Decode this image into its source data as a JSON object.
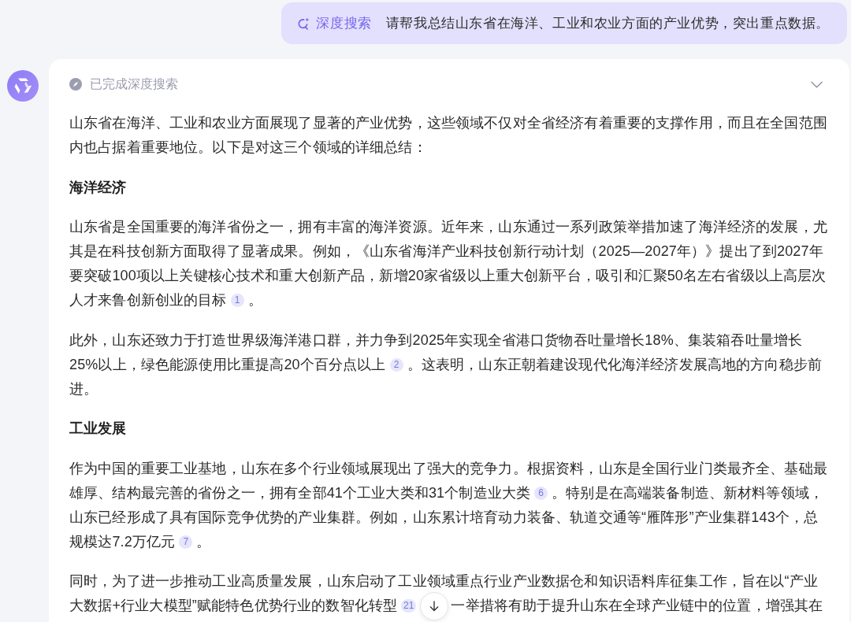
{
  "user_message": {
    "mode_tag": "深度搜索",
    "text": "请帮我总结山东省在海洋、工业和农业方面的产业优势，突出重点数据。"
  },
  "answer": {
    "status": "已完成深度搜索",
    "blocks": [
      {
        "kind": "paragraph",
        "segments": [
          {
            "kind": "text",
            "text": "山东省在海洋、工业和农业方面展现了显著的产业优势，这些领域不仅对全省经济有着重要的支撑作用，而且在全国范围内也占据着重要地位。以下是对这三个领域的详细总结："
          }
        ]
      },
      {
        "kind": "heading",
        "text": "海洋经济"
      },
      {
        "kind": "paragraph",
        "segments": [
          {
            "kind": "text",
            "text": "山东省是全国重要的海洋省份之一，拥有丰富的海洋资源。近年来，山东通过一系列政策举措加速了海洋经济的发展，尤其是在科技创新方面取得了显著成果。例如，《山东省海洋产业科技创新行动计划（2025—2027年）》提出了到2027年要突破100项以上关键核心技术和重大创新产品，新增20家省级以上重大创新平台，吸引和汇聚50名左右省级以上高层次人才来鲁创新创业的目标"
          },
          {
            "kind": "citation",
            "text": "1"
          },
          {
            "kind": "text",
            "text": "。"
          }
        ]
      },
      {
        "kind": "paragraph",
        "segments": [
          {
            "kind": "text",
            "text": "此外，山东还致力于打造世界级海洋港口群，并力争到2025年实现全省港口货物吞吐量增长18%、集装箱吞吐量增长25%以上，绿色能源使用比重提高20个百分点以上"
          },
          {
            "kind": "citation",
            "text": "2"
          },
          {
            "kind": "text",
            "text": "。这表明，山东正朝着建设现代化海洋经济发展高地的方向稳步前进。"
          }
        ]
      },
      {
        "kind": "heading",
        "text": "工业发展"
      },
      {
        "kind": "paragraph",
        "segments": [
          {
            "kind": "text",
            "text": "作为中国的重要工业基地，山东在多个行业领域展现出了强大的竞争力。根据资料，山东是全国行业门类最齐全、基础最雄厚、结构最完善的省份之一，拥有全部41个工业大类和31个制造业大类"
          },
          {
            "kind": "citation",
            "text": "6"
          },
          {
            "kind": "text",
            "text": "。特别是在高端装备制造、新材料等领域，山东已经形成了具有国际竞争优势的产业集群。例如，山东累计培育动力装备、轨道交通等“雁阵形”产业集群143个，总规模达7.2万亿元"
          },
          {
            "kind": "citation",
            "text": "7"
          },
          {
            "kind": "text",
            "text": "。"
          }
        ]
      },
      {
        "kind": "paragraph",
        "segments": [
          {
            "kind": "text",
            "text": "同时，为了进一步推动工业高质量发展，山东启动了工业领域重点行业产业数据仓和知识语料库征集工作，旨在以“产业大数据+行业大模型”赋能特色优势行业的数智化转型"
          },
          {
            "kind": "citation",
            "text": "21"
          },
          {
            "kind": "text",
            "text": "一举措将有助于提升山东在全球产业链中的位置，增强其在"
          }
        ]
      }
    ]
  }
}
